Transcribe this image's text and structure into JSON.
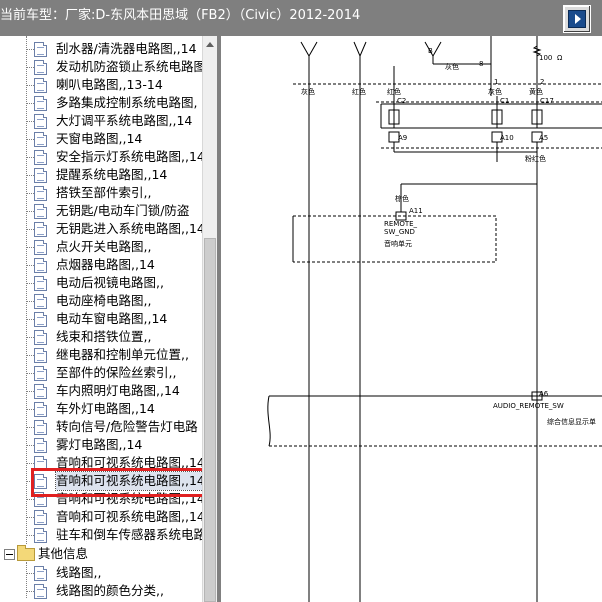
{
  "window": {
    "title": "当前车型：厂家:D-东风本田思域（FB2）（Civic）2012-2014"
  },
  "tree": {
    "items": [
      {
        "label": "刮水器/清洗器电路图,,14"
      },
      {
        "label": "发动机防盗锁止系统电路图"
      },
      {
        "label": "喇叭电路图,,13-14"
      },
      {
        "label": "多路集成控制系统电路图,"
      },
      {
        "label": "大灯调平系统电路图,,14"
      },
      {
        "label": "天窗电路图,,14"
      },
      {
        "label": "安全指示灯系统电路图,,14"
      },
      {
        "label": "提醒系统电路图,,14"
      },
      {
        "label": "搭铁至部件索引,,"
      },
      {
        "label": "无钥匙/电动车门锁/防盗"
      },
      {
        "label": "无钥匙进入系统电路图,,14"
      },
      {
        "label": "点火开关电路图,,"
      },
      {
        "label": "点烟器电路图,,14"
      },
      {
        "label": "电动后视镜电路图,,"
      },
      {
        "label": "电动座椅电路图,,"
      },
      {
        "label": "电动车窗电路图,,14"
      },
      {
        "label": "线束和搭铁位置,,"
      },
      {
        "label": "继电器和控制单元位置,,"
      },
      {
        "label": "至部件的保险丝索引,,"
      },
      {
        "label": "车内照明灯电路图,,14"
      },
      {
        "label": "车外灯电路图,,14"
      },
      {
        "label": "转向信号/危险警告灯电路"
      },
      {
        "label": "雾灯电路图,,14"
      },
      {
        "label": "音响和可视系统电路图,,14"
      },
      {
        "label": "音响和可视系统电路图,,14"
      },
      {
        "label": "音响和可视系统电路图,,14"
      },
      {
        "label": "音响和可视系统电路图,,14"
      },
      {
        "label": "驻车和倒车传感器系统电路"
      }
    ],
    "selected_index": 24,
    "folder": {
      "label": "其他信息"
    },
    "sub_items": [
      {
        "label": "线路图,,"
      },
      {
        "label": "线路图的颜色分类,,"
      }
    ]
  },
  "diagram": {
    "wire_colors": {
      "gray1": "灰色",
      "red1": "红色",
      "red2": "红色",
      "gray2": "灰色",
      "yellow": "黄色",
      "pink": "粉红色",
      "brown": "棕色",
      "gray3": "灰色"
    },
    "resistor_value": "100",
    "ohm": "Ω",
    "pins": {
      "n8": "8",
      "n1": "1",
      "n2": "2",
      "c2": "C2",
      "c1": "C1",
      "c17": "C17",
      "a9": "A9",
      "a10": "A10",
      "a5": "A5",
      "a11": "A11",
      "a6": "A6",
      "b": "B"
    },
    "remote_label1": "REMOTE_",
    "remote_label2": "SW_GND",
    "audio_unit": "音响单元",
    "audio_remote_sw": "AUDIO_REMOTE_SW",
    "info_display": "综合信息显示单"
  },
  "colors": {
    "titlebar": "#7f7f7f",
    "highlight": "#e02020",
    "splitter": "#808080"
  }
}
